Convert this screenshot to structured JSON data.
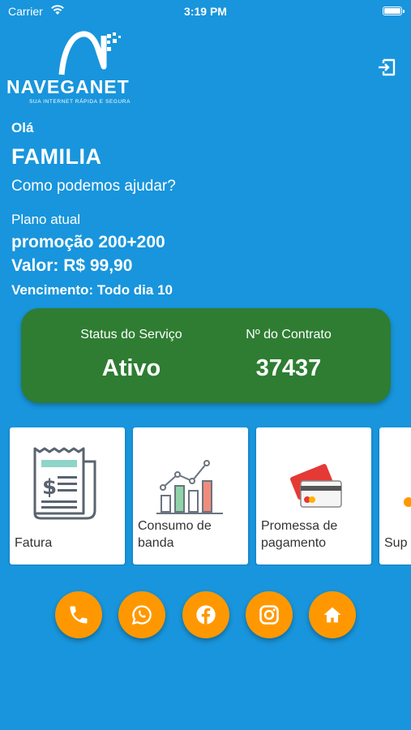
{
  "status_bar": {
    "carrier": "Carrier",
    "time": "3:19 PM"
  },
  "logo": {
    "name": "NAVEGANET",
    "tagline": "SUA INTERNET RÁPIDA E SEGURA"
  },
  "greeting": "Olá",
  "user_name": "FAMILIA",
  "help_text": "Como podemos ajudar?",
  "plan": {
    "label": "Plano atual",
    "name": "promoção 200+200",
    "value": "Valor: R$ 99,90",
    "due": "Vencimento: Todo dia 10"
  },
  "service_card": {
    "status_label": "Status do Serviço",
    "status_value": "Ativo",
    "contract_label": "Nº do Contrato",
    "contract_value": "37437",
    "color": "#2e7d32"
  },
  "menu": [
    {
      "label": "Fatura",
      "icon": "invoice-icon"
    },
    {
      "label": "Consumo de banda",
      "icon": "bandwidth-chart-icon"
    },
    {
      "label": "Promessa de pagamento",
      "icon": "credit-card-icon"
    },
    {
      "label": "Sup",
      "icon": "support-icon"
    }
  ],
  "social": [
    {
      "icon": "phone-icon"
    },
    {
      "icon": "whatsapp-icon"
    },
    {
      "icon": "facebook-icon"
    },
    {
      "icon": "instagram-icon"
    },
    {
      "icon": "home-icon"
    }
  ],
  "colors": {
    "background": "#1895dc",
    "accent": "#ff9800",
    "status_card": "#2e7d32"
  }
}
